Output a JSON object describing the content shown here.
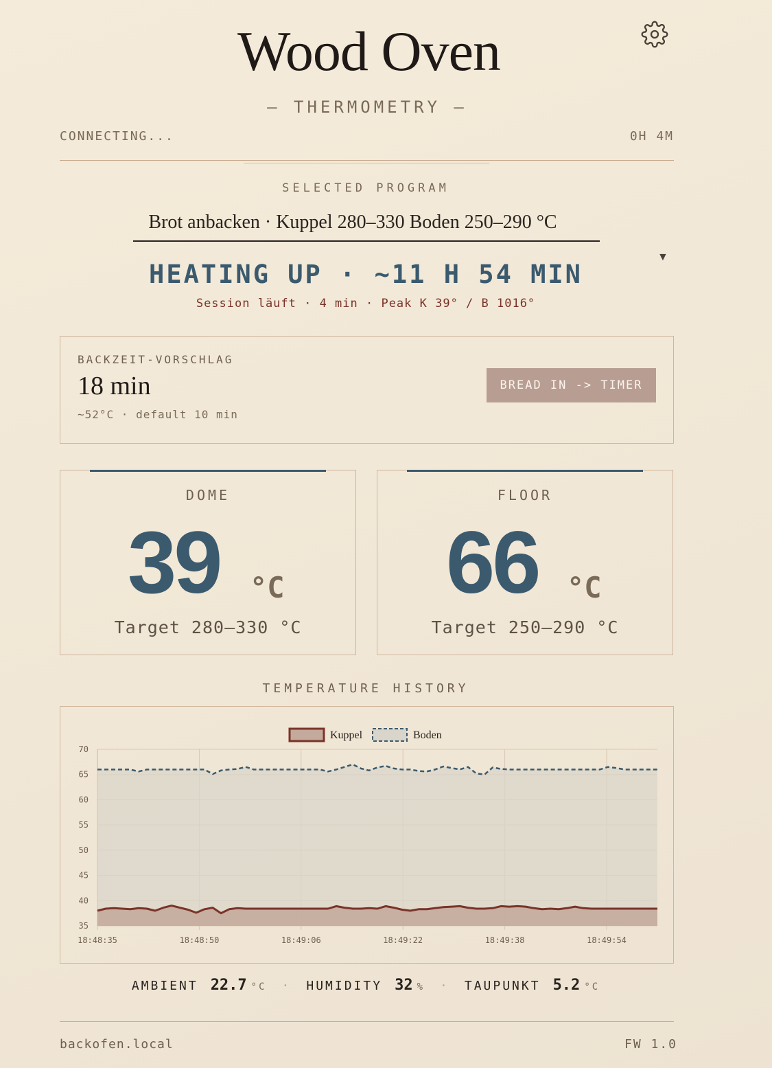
{
  "header": {
    "title": "Wood Oven",
    "subtitle": "— THERMOMETRY —",
    "connection_status": "CONNECTING...",
    "uptime": "0H 4M"
  },
  "program": {
    "label": "SELECTED PROGRAM",
    "selected": "Brot anbacken · Kuppel 280–330 Boden 250–290 °C"
  },
  "status": {
    "phase": "HEATING UP · ~11 H 54 MIN",
    "session": "Session läuft · 4 min · Peak K 39° / B 1016°"
  },
  "bake": {
    "label": "BACKZEIT-VORSCHLAG",
    "value": "18 min",
    "sub": "~52°C · default 10 min",
    "button_label": "BREAD IN -> TIMER"
  },
  "dome": {
    "label": "DOME",
    "value": "39",
    "unit": "°C",
    "target": "Target 280–330 °C"
  },
  "floor": {
    "label": "FLOOR",
    "value": "66",
    "unit": "°C",
    "target": "Target 250–290 °C"
  },
  "history": {
    "label": "TEMPERATURE HISTORY"
  },
  "chart_data": {
    "type": "area",
    "ylim": [
      35,
      70
    ],
    "yticks": [
      "70",
      "65",
      "60",
      "55",
      "50",
      "45",
      "40",
      "35"
    ],
    "xticks": [
      "18:48:35",
      "18:48:50",
      "18:49:06",
      "18:49:22",
      "18:49:38",
      "18:49:54"
    ],
    "legend": [
      "Kuppel",
      "Boden"
    ],
    "series": [
      {
        "name": "Kuppel",
        "color": "#7a3328",
        "fill": "#c4aa9c",
        "values": [
          38,
          38.4,
          38.5,
          38.4,
          38.3,
          38.5,
          38.4,
          38.0,
          38.6,
          39.0,
          38.6,
          38.2,
          37.6,
          38.3,
          38.6,
          37.5,
          38.3,
          38.5,
          38.4,
          38.4,
          38.4,
          38.4,
          38.4,
          38.4,
          38.4,
          38.4,
          38.4,
          38.4,
          38.4,
          38.9,
          38.6,
          38.4,
          38.4,
          38.5,
          38.4,
          38.9,
          38.6,
          38.2,
          38.0,
          38.3,
          38.3,
          38.5,
          38.7,
          38.8,
          38.9,
          38.6,
          38.4,
          38.4,
          38.5,
          38.9,
          38.8,
          38.9,
          38.8,
          38.5,
          38.3,
          38.4,
          38.3,
          38.5,
          38.8,
          38.5,
          38.4,
          38.4,
          38.4,
          38.4,
          38.4,
          38.4,
          38.4,
          38.4,
          38.4
        ]
      },
      {
        "name": "Boden",
        "color": "#3b5a6e",
        "fill": "#d9d5ca",
        "values": [
          66,
          66,
          66,
          66,
          66,
          65.6,
          66,
          66,
          66,
          66,
          66,
          66,
          66,
          66,
          65.1,
          65.8,
          66,
          66.1,
          66.5,
          66,
          66,
          66,
          66,
          66,
          66,
          66,
          66,
          66,
          65.6,
          66,
          66.5,
          67.0,
          66.2,
          65.8,
          66.4,
          66.7,
          66.2,
          66,
          66,
          65.7,
          65.6,
          66,
          66.6,
          66.3,
          66.0,
          66.5,
          65.2,
          65.0,
          66.4,
          66.1,
          66,
          66,
          66,
          66,
          66,
          66,
          66,
          66,
          66,
          66,
          66,
          66,
          66.5,
          66.3,
          66,
          66,
          66,
          66,
          66
        ]
      }
    ]
  },
  "environment": {
    "ambient_label": "AMBIENT",
    "ambient_value": "22.7",
    "ambient_unit": "°C",
    "humidity_label": "HUMIDITY",
    "humidity_value": "32",
    "humidity_unit": "%",
    "dewpoint_label": "TAUPUNKT",
    "dewpoint_value": "5.2",
    "dewpoint_unit": "°C",
    "separator": "·"
  },
  "footer": {
    "host": "backofen.local",
    "firmware": "FW 1.0"
  }
}
